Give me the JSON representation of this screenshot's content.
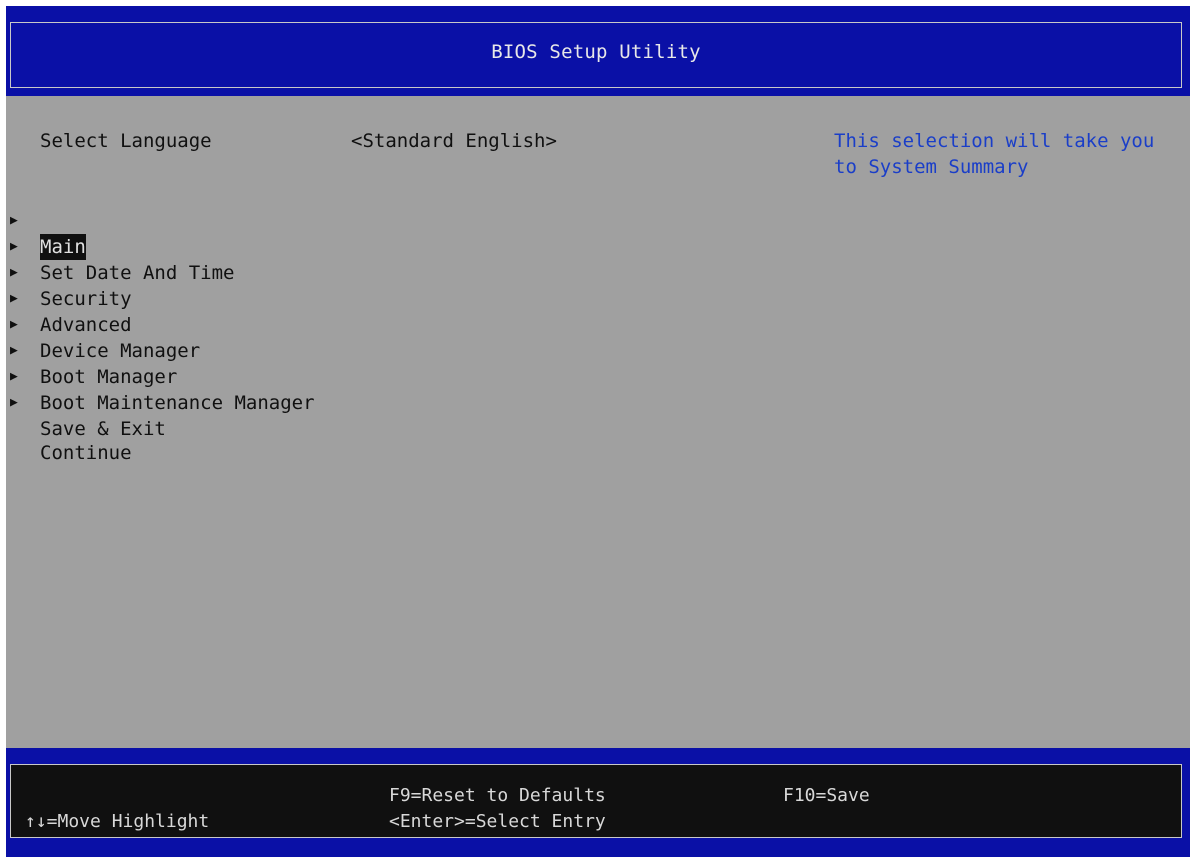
{
  "header": {
    "title": "BIOS Setup Utility"
  },
  "language": {
    "label": "Select Language",
    "value": "<Standard English>"
  },
  "help": {
    "text": "This selection will take you to System Summary"
  },
  "menu": {
    "items": [
      {
        "label": "Main",
        "selected": true
      },
      {
        "label": "Set Date And Time"
      },
      {
        "label": "Security"
      },
      {
        "label": "Advanced"
      },
      {
        "label": "Device Manager"
      },
      {
        "label": "Boot Manager"
      },
      {
        "label": "Boot Maintenance Manager"
      },
      {
        "label": "Save & Exit"
      }
    ],
    "arrow_glyph": "▶",
    "continue_label": "Continue"
  },
  "footer": {
    "move": "↑↓=Move Highlight",
    "reset": "F9=Reset to Defaults",
    "select": "<Enter>=Select Entry",
    "save": "F10=Save"
  },
  "colors": {
    "header_blue": "#0a10a6",
    "panel_gray": "#a0a0a0",
    "help_text_blue": "#1a3ec8",
    "footer_black": "#101010"
  }
}
